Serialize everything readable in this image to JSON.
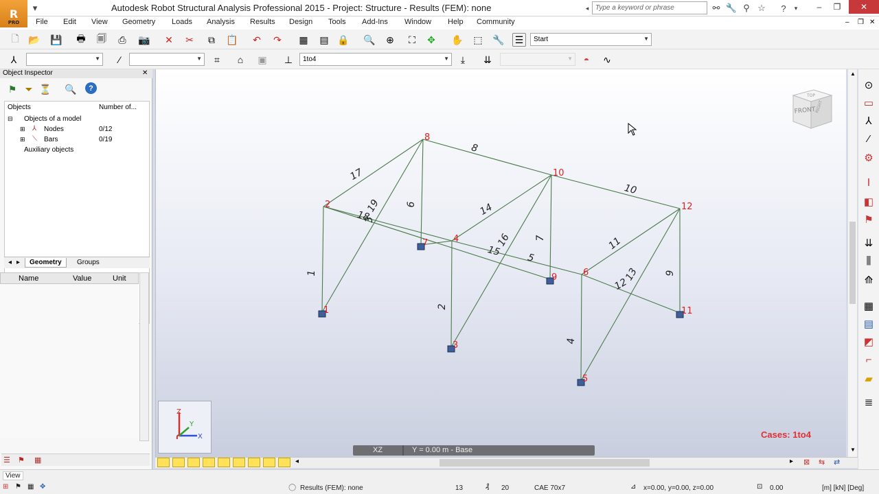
{
  "window": {
    "title": "Autodesk Robot Structural Analysis Professional 2015 - Project: Structure - Results (FEM): none",
    "logo_badge": "PRO",
    "search_placeholder": "Type a keyword or phrase"
  },
  "menu": [
    "File",
    "Edit",
    "View",
    "Geometry",
    "Loads",
    "Analysis",
    "Results",
    "Design",
    "Tools",
    "Add-Ins",
    "Window",
    "Help",
    "Community"
  ],
  "toolbar": {
    "layout_combo": "Start",
    "bar_combo": "",
    "section_combo": "",
    "cases_combo": "1to4",
    "disabled_combo": ""
  },
  "object_inspector": {
    "title": "Object Inspector",
    "col_objects": "Objects",
    "col_number": "Number of...",
    "rows": [
      {
        "label": "Objects of a model",
        "count": ""
      },
      {
        "label": "Nodes",
        "count": "0/12"
      },
      {
        "label": "Bars",
        "count": "0/19"
      },
      {
        "label": "Auxiliary objects",
        "count": ""
      }
    ],
    "tabs": [
      "Geometry",
      "Groups"
    ],
    "props_columns": [
      "Name",
      "Value",
      "Unit"
    ]
  },
  "viewport": {
    "cases_label": "Cases: 1to4",
    "view_plane": "XZ",
    "view_level": "Y = 0.00 m - Base",
    "viewcube_labels": {
      "front": "FRONT",
      "top": "TOP",
      "right": "RIGHT"
    },
    "axis_labels": {
      "x": "X",
      "y": "Y",
      "z": "Z"
    },
    "node_labels": [
      "1",
      "2",
      "3",
      "4",
      "5",
      "6",
      "7",
      "8",
      "9",
      "10",
      "11",
      "12"
    ],
    "bar_labels": [
      "1",
      "2",
      "3",
      "4",
      "5",
      "6",
      "7",
      "8",
      "9",
      "10",
      "11",
      "12",
      "13",
      "14",
      "15",
      "16",
      "17",
      "18",
      "19"
    ]
  },
  "status": {
    "view_label": "View",
    "results": "Results (FEM): none",
    "nodes": "13",
    "bars": "20",
    "section": "CAE 70x7",
    "coords": "x=0.00, y=0.00, z=0.00",
    "angle": "0.00",
    "units": "[m] [kN] [Deg]"
  }
}
